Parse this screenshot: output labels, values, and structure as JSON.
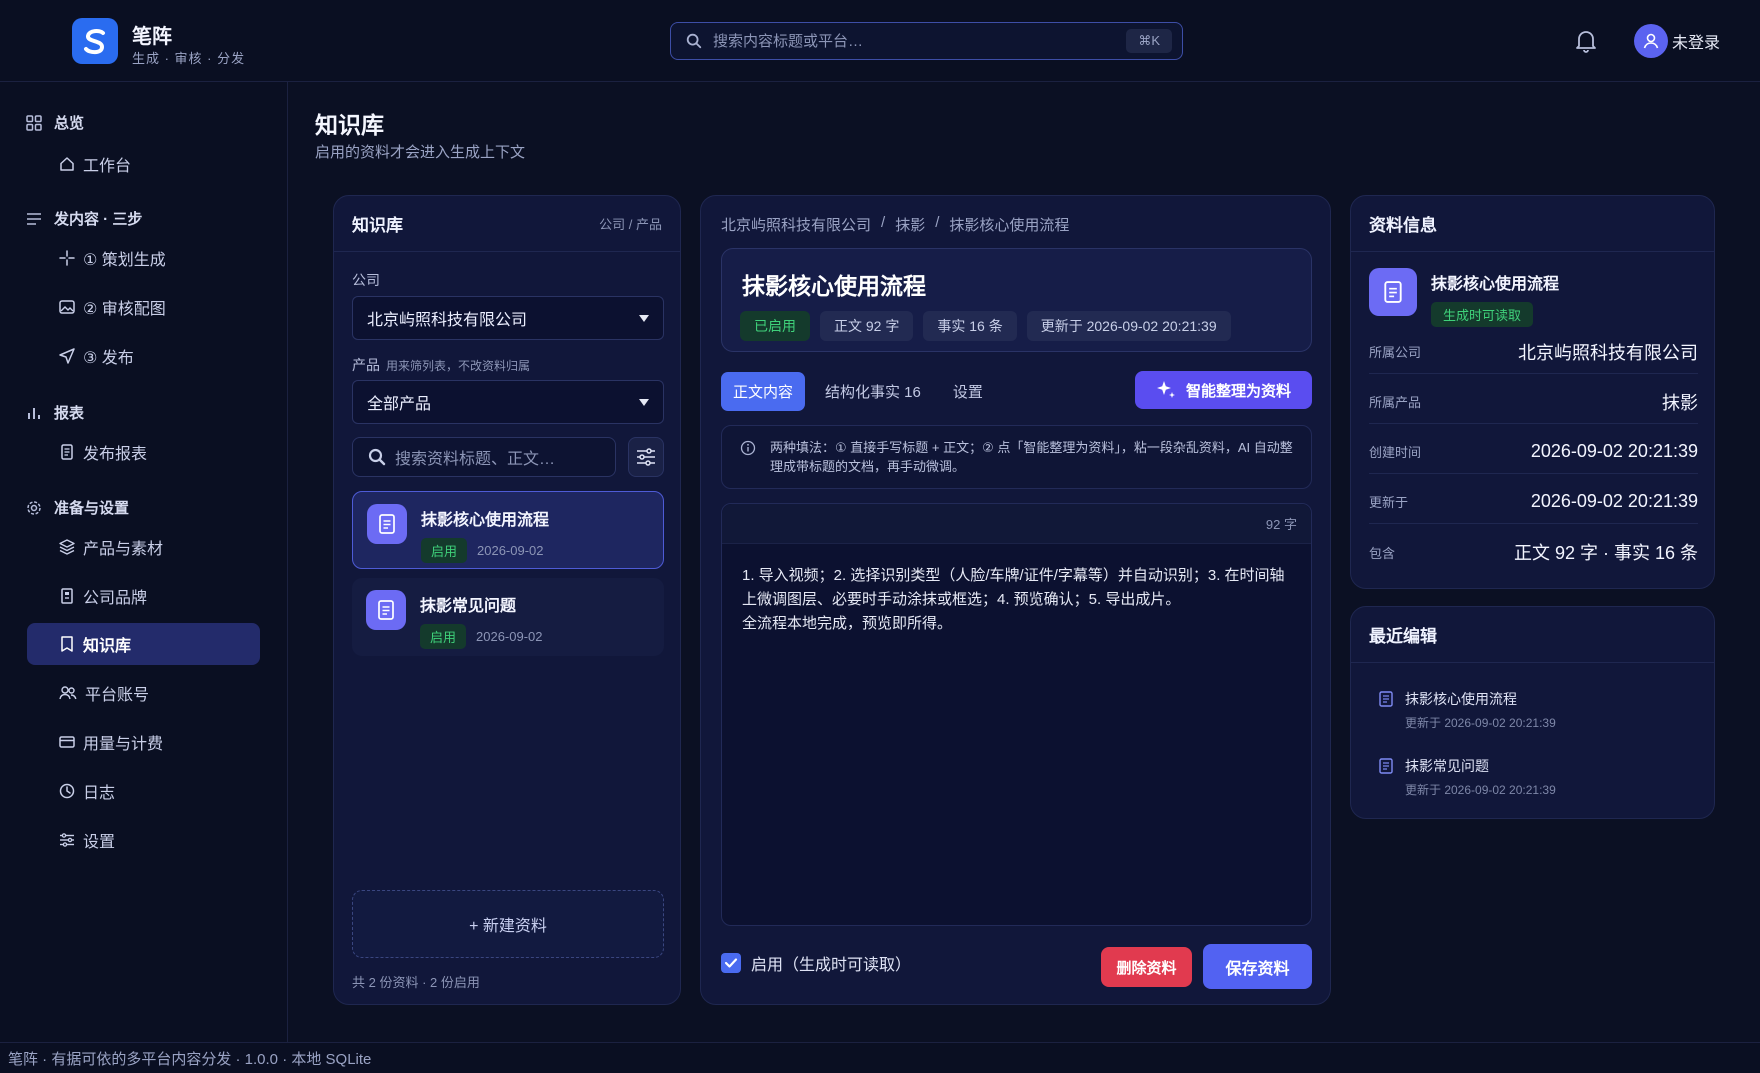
{
  "header": {
    "brand_name": "笔阵",
    "brand_sub": "生成 · 审核 · 分发",
    "search_placeholder": "搜索内容标题或平台…",
    "search_shortcut": "⌘K",
    "user_label": "未登录"
  },
  "sidebar": {
    "sections": [
      {
        "title": "总览",
        "icon": "grid-icon",
        "items": [
          {
            "label": "工作台",
            "icon": "home-icon"
          }
        ]
      },
      {
        "title": "发内容 · 三步",
        "icon": "list-icon",
        "items": [
          {
            "label": "① 策划生成",
            "icon": "sparkle-icon"
          },
          {
            "label": "② 审核配图",
            "icon": "image-icon"
          },
          {
            "label": "③ 发布",
            "icon": "send-icon"
          }
        ]
      },
      {
        "title": "报表",
        "icon": "bar-chart-icon",
        "items": [
          {
            "label": "发布报表",
            "icon": "document-icon"
          }
        ]
      },
      {
        "title": "准备与设置",
        "icon": "gear-icon",
        "items": [
          {
            "label": "产品与素材",
            "icon": "layers-icon"
          },
          {
            "label": "公司品牌",
            "icon": "building-icon"
          },
          {
            "label": "知识库",
            "icon": "bookmark-icon",
            "active": true
          },
          {
            "label": "平台账号",
            "icon": "users-icon"
          },
          {
            "label": "用量与计费",
            "icon": "card-icon"
          },
          {
            "label": "日志",
            "icon": "clock-icon"
          },
          {
            "label": "设置",
            "icon": "sliders-icon"
          }
        ]
      }
    ]
  },
  "page": {
    "title": "知识库",
    "subtitle": "启用的资料才会进入生成上下文"
  },
  "left_panel": {
    "title": "知识库",
    "hint": "公司 / 产品",
    "company_label": "公司",
    "company_value": "北京屿照科技有限公司",
    "product_label": "产品",
    "product_hint": "用来筛列表，不改资料归属",
    "product_value": "全部产品",
    "search_placeholder": "搜索资料标题、正文…",
    "docs": [
      {
        "name": "抹影核心使用流程",
        "status": "启用",
        "date": "2026-09-02",
        "active": true
      },
      {
        "name": "抹影常见问题",
        "status": "启用",
        "date": "2026-09-02",
        "active": false
      }
    ],
    "new_button": "+ 新建资料",
    "footer": "共 2 份资料 · 2 份启用"
  },
  "middle_panel": {
    "breadcrumb": [
      "北京屿照科技有限公司",
      "抹影",
      "抹影核心使用流程"
    ],
    "title": "抹影核心使用流程",
    "chips": [
      "已启用",
      "正文 92 字",
      "事实 16 条",
      "更新于 2026-09-02 20:21:39"
    ],
    "tabs": [
      "正文内容",
      "结构化事实 16",
      "设置"
    ],
    "ai_button": "智能整理为资料",
    "info_text": "两种填法：① 直接手写标题 + 正文；② 点「智能整理为资料」，粘一段杂乱资料，AI 自动整理成带标题的文档，再手动微调。",
    "char_count": "92 字",
    "body": "1. 导入视频；2. 选择识别类型（人脸/车牌/证件/字幕等）并自动识别；3. 在时间轴上微调图层、必要时手动涂抹或框选；4. 预览确认；5. 导出成片。\n全流程本地完成，预览即所得。",
    "enable_label": "启用（生成时可读取）",
    "delete_button": "删除资料",
    "save_button": "保存资料"
  },
  "info_panel": {
    "title": "资料信息",
    "doc_name": "抹影核心使用流程",
    "doc_badge": "生成时可读取",
    "rows": [
      {
        "k": "所属公司",
        "v": "北京屿照科技有限公司"
      },
      {
        "k": "所属产品",
        "v": "抹影"
      },
      {
        "k": "创建时间",
        "v": "2026-09-02 20:21:39"
      },
      {
        "k": "更新于",
        "v": "2026-09-02 20:21:39"
      },
      {
        "k": "包含",
        "v": "正文 92 字 · 事实 16 条"
      }
    ]
  },
  "recent_panel": {
    "title": "最近编辑",
    "items": [
      {
        "name": "抹影核心使用流程",
        "time": "更新于 2026-09-02 20:21:39"
      },
      {
        "name": "抹影常见问题",
        "time": "更新于 2026-09-02 20:21:39"
      }
    ]
  },
  "footer": {
    "text": "笔阵 · 有据可依的多平台内容分发 · 1.0.0 · 本地 SQLite"
  },
  "colors": {
    "background": "#0b1023",
    "accent": "#4a6bf0",
    "ai_button": "#5a4df0",
    "danger": "#e13a4f",
    "success": "#3fd17a"
  }
}
